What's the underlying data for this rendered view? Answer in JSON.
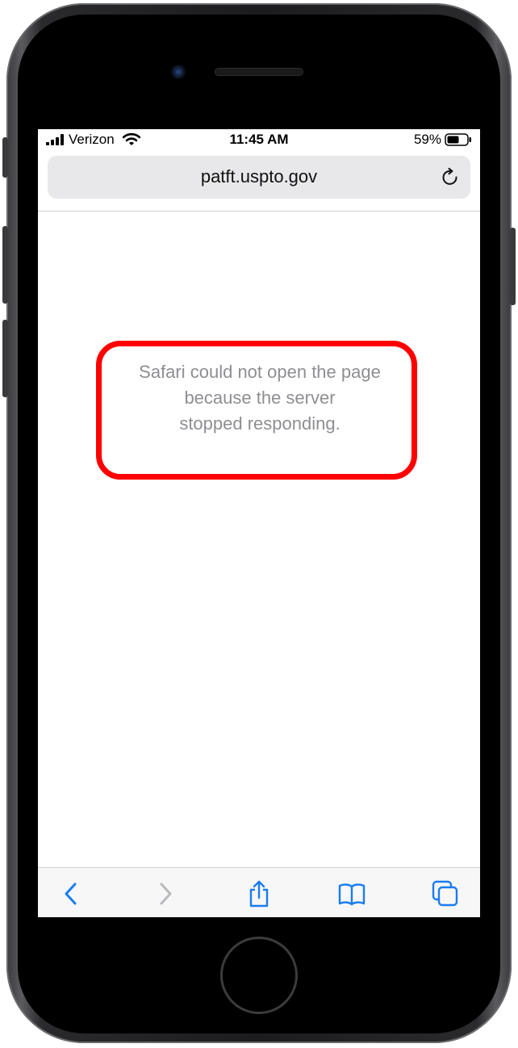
{
  "status_bar": {
    "carrier": "Verizon",
    "time": "11:45 AM",
    "battery_percent": "59%",
    "icons": [
      "signal-icon",
      "wifi-icon",
      "battery-icon"
    ]
  },
  "browser": {
    "url": "patft.uspto.gov",
    "reload_icon": "reload-icon"
  },
  "error": {
    "lines": [
      "Safari could not open the page",
      "because the server",
      "stopped responding."
    ],
    "highlight_color": "#ff0000"
  },
  "toolbar": {
    "items": [
      "back-icon",
      "forward-icon",
      "share-icon",
      "bookmarks-icon",
      "tabs-icon"
    ],
    "accent_color": "#1a7cf0",
    "disabled_color": "#b9b9bd"
  }
}
